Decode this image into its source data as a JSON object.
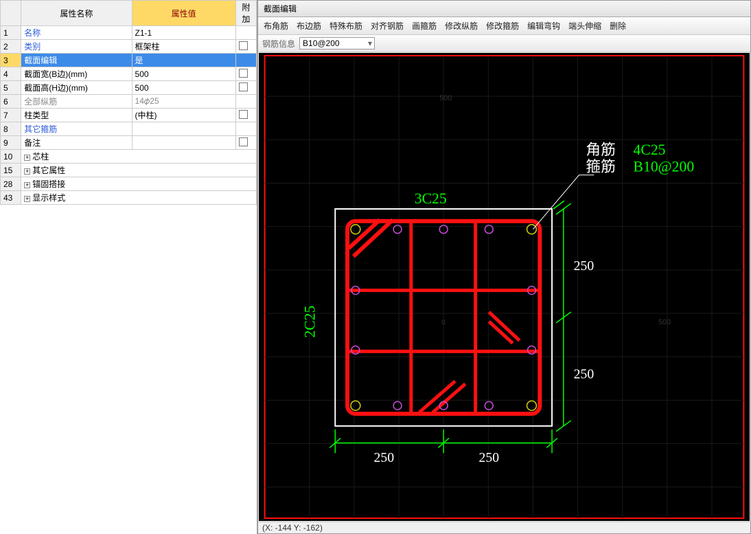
{
  "prop_header": {
    "name": "属性名称",
    "value": "属性值",
    "addon": "附加"
  },
  "rows": [
    {
      "num": 1,
      "name": "名称",
      "value": "Z1-1",
      "cls": "blue-text"
    },
    {
      "num": 2,
      "name": "类别",
      "value": "框架柱",
      "cls": "blue-text",
      "check": true
    },
    {
      "num": 3,
      "name": "截面编辑",
      "value": "是",
      "sel": true
    },
    {
      "num": 4,
      "name": "截面宽(B边)(mm)",
      "value": "500",
      "check": true
    },
    {
      "num": 5,
      "name": "截面高(H边)(mm)",
      "value": "500",
      "check": true
    },
    {
      "num": 6,
      "name": "全部纵筋",
      "value": "14𝜙25",
      "gray": true
    },
    {
      "num": 7,
      "name": "柱类型",
      "value": "(中柱)",
      "check": true
    },
    {
      "num": 8,
      "name": "其它箍筋",
      "value": "",
      "cls": "blue-text"
    },
    {
      "num": 9,
      "name": "备注",
      "value": "",
      "check": true
    },
    {
      "num": 10,
      "name": "芯柱",
      "expand": true
    },
    {
      "num": 15,
      "name": "其它属性",
      "expand": true
    },
    {
      "num": 28,
      "name": "锚固搭接",
      "expand": true
    },
    {
      "num": 43,
      "name": "显示样式",
      "expand": true
    }
  ],
  "panel_title": "截面编辑",
  "toolbar1": [
    "布角筋",
    "布边筋",
    "特殊布筋",
    "对齐钢筋",
    "画箍筋",
    "修改纵筋",
    "修改箍筋",
    "编辑弯钩",
    "端头伸缩",
    "删除"
  ],
  "toolbar2_label": "钢筋信息",
  "toolbar2_value": "B10@200",
  "status": "(X: -144 Y: -162)",
  "diagram": {
    "top_label": "3C25",
    "left_label": "2C25",
    "dim_v1": "250",
    "dim_v2": "250",
    "dim_h1": "250",
    "dim_h2": "250",
    "legend1_lbl": "角筋",
    "legend1_val": "4C25",
    "legend2_lbl": "箍筋",
    "legend2_val": "B10@200",
    "axis_x": "500",
    "axis_y": "500"
  }
}
